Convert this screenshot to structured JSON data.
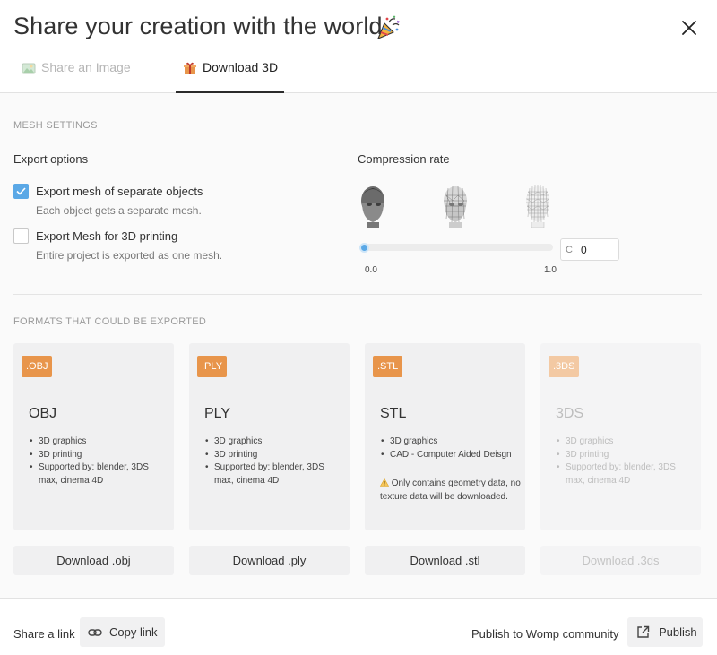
{
  "header": {
    "title": "Share your creation with the world",
    "title_icon": "party-popper-icon",
    "close_icon": "close-icon",
    "tabs": [
      {
        "label": "Share an Image",
        "icon": "image-icon",
        "active": false
      },
      {
        "label": "Download 3D",
        "icon": "gift-icon",
        "active": true
      }
    ]
  },
  "mesh_settings": {
    "section_label": "MESH SETTINGS",
    "export_options_label": "Export options",
    "options": [
      {
        "label": "Export mesh of separate objects",
        "description": "Each object gets a separate mesh.",
        "checked": true
      },
      {
        "label": "Export Mesh for 3D printing",
        "description": "Entire project is exported as one mesh.",
        "checked": false
      }
    ],
    "compression": {
      "label": "Compression rate",
      "previews": [
        "head-smooth-icon",
        "head-medium-wireframe-icon",
        "head-low-wireframe-icon"
      ],
      "min_label": "0.0",
      "max_label": "1.0",
      "value_fraction": 0.0,
      "input_prefix": "C",
      "input_value": "0"
    }
  },
  "formats": {
    "section_label": "FORMATS THAT COULD BE EXPORTED",
    "cards": [
      {
        "badge": ".OBJ",
        "name": "OBJ",
        "bullets": [
          "3D graphics",
          "3D printing",
          "Supported by: blender, 3DS max, cinema 4D"
        ],
        "note": "",
        "button": "Download .obj",
        "enabled": true
      },
      {
        "badge": ".PLY",
        "name": "PLY",
        "bullets": [
          "3D graphics",
          "3D printing",
          "Supported by: blender, 3DS max, cinema 4D"
        ],
        "note": "",
        "button": "Download .ply",
        "enabled": true
      },
      {
        "badge": ".STL",
        "name": "STL",
        "bullets": [
          "3D graphics",
          "CAD - Computer Aided Deisgn"
        ],
        "note": "Only contains geometry data, no texture data will be downloaded.",
        "button": "Download .stl",
        "enabled": true
      },
      {
        "badge": ".3DS",
        "name": "3DS",
        "bullets": [
          "3D graphics",
          "3D printing",
          "Supported by: blender, 3DS max, cinema 4D"
        ],
        "note": "",
        "button": "Download .3ds",
        "enabled": false
      }
    ]
  },
  "footer": {
    "share_label": "Share a link",
    "copy_link_label": "Copy link",
    "publish_text": "Publish to Womp community",
    "publish_label": "Publish"
  },
  "colors": {
    "accent_blue": "#5aa8e6",
    "badge_orange": "#e8954b",
    "badge_orange_disabled": "#f3c9a3",
    "warning_yellow": "#e6a817"
  }
}
